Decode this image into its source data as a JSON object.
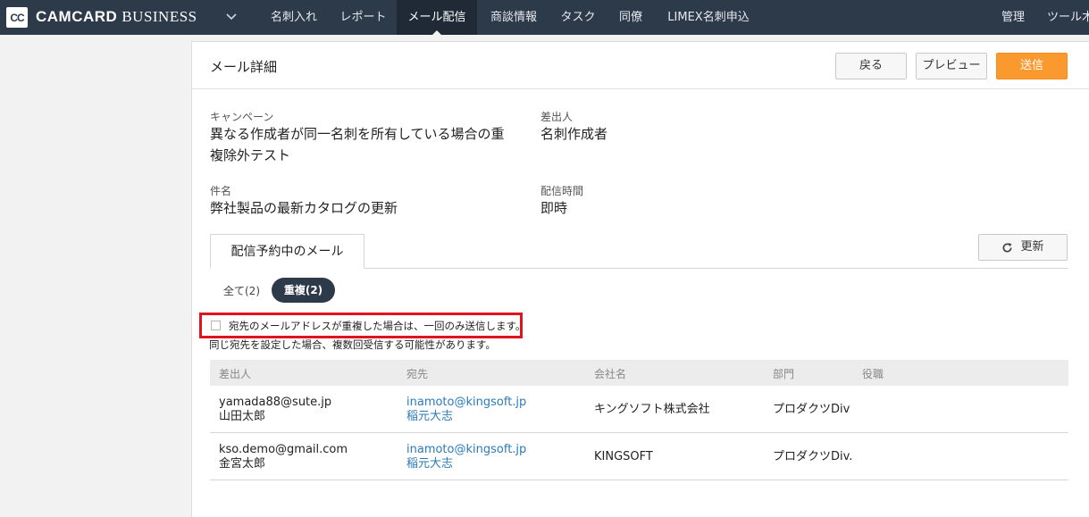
{
  "nav": {
    "logo_text": "CC",
    "brand_bold": "CAMCARD",
    "brand_light": "BUSINESS",
    "items": [
      {
        "label": "名刺入れ"
      },
      {
        "label": "レポート"
      },
      {
        "label": "メール配信"
      },
      {
        "label": "商談情報"
      },
      {
        "label": "タスク"
      },
      {
        "label": "同僚"
      },
      {
        "label": "LIMEX名刺申込"
      }
    ],
    "right_items": [
      {
        "label": "管理"
      },
      {
        "label": "ツール木"
      }
    ],
    "active_index": 2
  },
  "header": {
    "title": "メール詳細",
    "back_label": "戻る",
    "preview_label": "プレビュー",
    "send_label": "送信"
  },
  "details": {
    "campaign_label": "キャンペーン",
    "campaign_value_line1": "異なる作成者が同一名刺を所有している場合の重",
    "campaign_value_line2": "複除外テスト",
    "sender_label": "差出人",
    "sender_value": "名刺作成者",
    "subject_label": "件名",
    "subject_value": "弊社製品の最新カタログの更新",
    "time_label": "配信時間",
    "time_value": "即時"
  },
  "tabs": [
    {
      "label": "配信予約中のメール"
    }
  ],
  "refresh_label": "更新",
  "filters": {
    "all_label": "全て(2)",
    "dup_label": "重複(2)"
  },
  "dedup": {
    "checkbox_label": "宛先のメールアドレスが重複した場合は、一回のみ送信します。",
    "checked": false,
    "note": "同じ宛先を設定した場合、複数回受信する可能性があります。"
  },
  "table": {
    "columns": [
      "差出人",
      "宛先",
      "会社名",
      "部門",
      "役職"
    ],
    "rows": [
      {
        "sender_email": "yamada88@sute.jp",
        "sender_name": "山田太郎",
        "to_email": "inamoto@kingsoft.jp",
        "to_name": "稲元大志",
        "company": "キングソフト株式会社",
        "department": "プロダクツDiv",
        "title": ""
      },
      {
        "sender_email": "kso.demo@gmail.com",
        "sender_name": "金宮太郎",
        "to_email": "inamoto@kingsoft.jp",
        "to_name": "稲元大志",
        "company": "KINGSOFT",
        "department": "プロダクツDiv.",
        "title": ""
      }
    ]
  },
  "colors": {
    "nav_bg": "#2d3a4a",
    "send_button": "#fa9a2e",
    "highlight_border": "#e0141e",
    "link": "#2b7bb9"
  }
}
